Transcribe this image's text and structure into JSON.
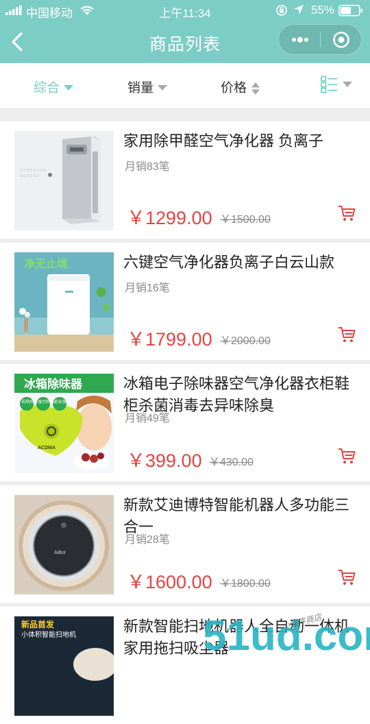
{
  "status": {
    "carrier": "中国移动",
    "time": "上午11:34",
    "battery": "55%"
  },
  "nav": {
    "title": "商品列表"
  },
  "filters": {
    "composite": "综合",
    "sales": "销量",
    "price": "价格",
    "layout_icon": "list-grid-icon"
  },
  "colors": {
    "accent": "#7ccdc5",
    "price": "#e64340"
  },
  "products": [
    {
      "name": "家用除甲醛空气净化器 负离子",
      "sales": "月销83笔",
      "price": "￥1299.00",
      "original_price": "￥1500.00"
    },
    {
      "name": "六键空气净化器负离子白云山款",
      "sales": "月销16笔",
      "price": "￥1799.00",
      "original_price": "￥2000.00"
    },
    {
      "name": "冰箱电子除味器空气净化器衣柜鞋柜杀菌消毒去异味除臭",
      "sales": "月销49笔",
      "price": "￥399.00",
      "original_price": "￥430.00"
    },
    {
      "name": "新款艾迪博特智能机器人多功能三合一",
      "sales": "月销28笔",
      "price": "￥1600.00",
      "original_price": "￥1800.00"
    },
    {
      "name": "新款智能扫地机器人全自动一体机家用拖扫吸尘器"
    }
  ],
  "images": {
    "p2_banner": "净无止境",
    "p3_banner": "冰箱除味器",
    "p3_tags": [
      "去除异味",
      "强力除菌",
      "延长保鲜"
    ],
    "p3_brand": "ACDMA",
    "p5_banner": "新品首发",
    "p5_sub": "小体积智能扫地机"
  },
  "watermark": {
    "text": "51ud.com",
    "handwriting": "小程序商店"
  }
}
